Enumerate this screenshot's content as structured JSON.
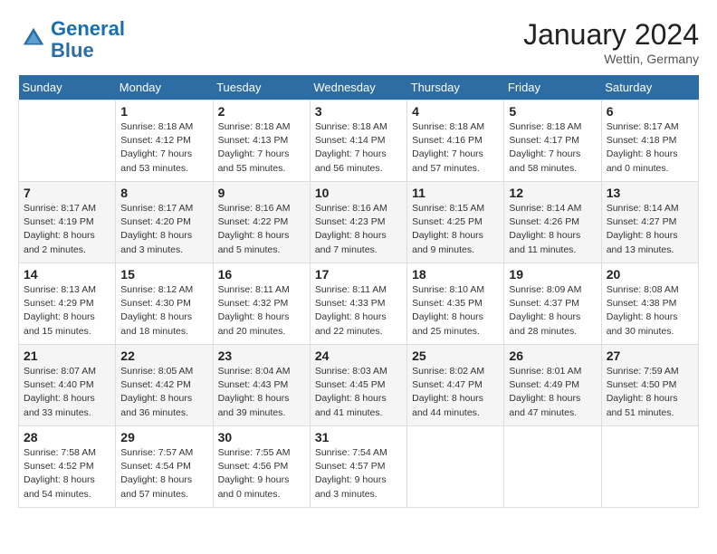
{
  "header": {
    "logo_line1": "General",
    "logo_line2": "Blue",
    "month_title": "January 2024",
    "location": "Wettin, Germany"
  },
  "weekdays": [
    "Sunday",
    "Monday",
    "Tuesday",
    "Wednesday",
    "Thursday",
    "Friday",
    "Saturday"
  ],
  "weeks": [
    [
      {
        "day": "",
        "sunrise": "",
        "sunset": "",
        "daylight": ""
      },
      {
        "day": "1",
        "sunrise": "Sunrise: 8:18 AM",
        "sunset": "Sunset: 4:12 PM",
        "daylight": "Daylight: 7 hours and 53 minutes."
      },
      {
        "day": "2",
        "sunrise": "Sunrise: 8:18 AM",
        "sunset": "Sunset: 4:13 PM",
        "daylight": "Daylight: 7 hours and 55 minutes."
      },
      {
        "day": "3",
        "sunrise": "Sunrise: 8:18 AM",
        "sunset": "Sunset: 4:14 PM",
        "daylight": "Daylight: 7 hours and 56 minutes."
      },
      {
        "day": "4",
        "sunrise": "Sunrise: 8:18 AM",
        "sunset": "Sunset: 4:16 PM",
        "daylight": "Daylight: 7 hours and 57 minutes."
      },
      {
        "day": "5",
        "sunrise": "Sunrise: 8:18 AM",
        "sunset": "Sunset: 4:17 PM",
        "daylight": "Daylight: 7 hours and 58 minutes."
      },
      {
        "day": "6",
        "sunrise": "Sunrise: 8:17 AM",
        "sunset": "Sunset: 4:18 PM",
        "daylight": "Daylight: 8 hours and 0 minutes."
      }
    ],
    [
      {
        "day": "7",
        "sunrise": "Sunrise: 8:17 AM",
        "sunset": "Sunset: 4:19 PM",
        "daylight": "Daylight: 8 hours and 2 minutes."
      },
      {
        "day": "8",
        "sunrise": "Sunrise: 8:17 AM",
        "sunset": "Sunset: 4:20 PM",
        "daylight": "Daylight: 8 hours and 3 minutes."
      },
      {
        "day": "9",
        "sunrise": "Sunrise: 8:16 AM",
        "sunset": "Sunset: 4:22 PM",
        "daylight": "Daylight: 8 hours and 5 minutes."
      },
      {
        "day": "10",
        "sunrise": "Sunrise: 8:16 AM",
        "sunset": "Sunset: 4:23 PM",
        "daylight": "Daylight: 8 hours and 7 minutes."
      },
      {
        "day": "11",
        "sunrise": "Sunrise: 8:15 AM",
        "sunset": "Sunset: 4:25 PM",
        "daylight": "Daylight: 8 hours and 9 minutes."
      },
      {
        "day": "12",
        "sunrise": "Sunrise: 8:14 AM",
        "sunset": "Sunset: 4:26 PM",
        "daylight": "Daylight: 8 hours and 11 minutes."
      },
      {
        "day": "13",
        "sunrise": "Sunrise: 8:14 AM",
        "sunset": "Sunset: 4:27 PM",
        "daylight": "Daylight: 8 hours and 13 minutes."
      }
    ],
    [
      {
        "day": "14",
        "sunrise": "Sunrise: 8:13 AM",
        "sunset": "Sunset: 4:29 PM",
        "daylight": "Daylight: 8 hours and 15 minutes."
      },
      {
        "day": "15",
        "sunrise": "Sunrise: 8:12 AM",
        "sunset": "Sunset: 4:30 PM",
        "daylight": "Daylight: 8 hours and 18 minutes."
      },
      {
        "day": "16",
        "sunrise": "Sunrise: 8:11 AM",
        "sunset": "Sunset: 4:32 PM",
        "daylight": "Daylight: 8 hours and 20 minutes."
      },
      {
        "day": "17",
        "sunrise": "Sunrise: 8:11 AM",
        "sunset": "Sunset: 4:33 PM",
        "daylight": "Daylight: 8 hours and 22 minutes."
      },
      {
        "day": "18",
        "sunrise": "Sunrise: 8:10 AM",
        "sunset": "Sunset: 4:35 PM",
        "daylight": "Daylight: 8 hours and 25 minutes."
      },
      {
        "day": "19",
        "sunrise": "Sunrise: 8:09 AM",
        "sunset": "Sunset: 4:37 PM",
        "daylight": "Daylight: 8 hours and 28 minutes."
      },
      {
        "day": "20",
        "sunrise": "Sunrise: 8:08 AM",
        "sunset": "Sunset: 4:38 PM",
        "daylight": "Daylight: 8 hours and 30 minutes."
      }
    ],
    [
      {
        "day": "21",
        "sunrise": "Sunrise: 8:07 AM",
        "sunset": "Sunset: 4:40 PM",
        "daylight": "Daylight: 8 hours and 33 minutes."
      },
      {
        "day": "22",
        "sunrise": "Sunrise: 8:05 AM",
        "sunset": "Sunset: 4:42 PM",
        "daylight": "Daylight: 8 hours and 36 minutes."
      },
      {
        "day": "23",
        "sunrise": "Sunrise: 8:04 AM",
        "sunset": "Sunset: 4:43 PM",
        "daylight": "Daylight: 8 hours and 39 minutes."
      },
      {
        "day": "24",
        "sunrise": "Sunrise: 8:03 AM",
        "sunset": "Sunset: 4:45 PM",
        "daylight": "Daylight: 8 hours and 41 minutes."
      },
      {
        "day": "25",
        "sunrise": "Sunrise: 8:02 AM",
        "sunset": "Sunset: 4:47 PM",
        "daylight": "Daylight: 8 hours and 44 minutes."
      },
      {
        "day": "26",
        "sunrise": "Sunrise: 8:01 AM",
        "sunset": "Sunset: 4:49 PM",
        "daylight": "Daylight: 8 hours and 47 minutes."
      },
      {
        "day": "27",
        "sunrise": "Sunrise: 7:59 AM",
        "sunset": "Sunset: 4:50 PM",
        "daylight": "Daylight: 8 hours and 51 minutes."
      }
    ],
    [
      {
        "day": "28",
        "sunrise": "Sunrise: 7:58 AM",
        "sunset": "Sunset: 4:52 PM",
        "daylight": "Daylight: 8 hours and 54 minutes."
      },
      {
        "day": "29",
        "sunrise": "Sunrise: 7:57 AM",
        "sunset": "Sunset: 4:54 PM",
        "daylight": "Daylight: 8 hours and 57 minutes."
      },
      {
        "day": "30",
        "sunrise": "Sunrise: 7:55 AM",
        "sunset": "Sunset: 4:56 PM",
        "daylight": "Daylight: 9 hours and 0 minutes."
      },
      {
        "day": "31",
        "sunrise": "Sunrise: 7:54 AM",
        "sunset": "Sunset: 4:57 PM",
        "daylight": "Daylight: 9 hours and 3 minutes."
      },
      {
        "day": "",
        "sunrise": "",
        "sunset": "",
        "daylight": ""
      },
      {
        "day": "",
        "sunrise": "",
        "sunset": "",
        "daylight": ""
      },
      {
        "day": "",
        "sunrise": "",
        "sunset": "",
        "daylight": ""
      }
    ]
  ]
}
